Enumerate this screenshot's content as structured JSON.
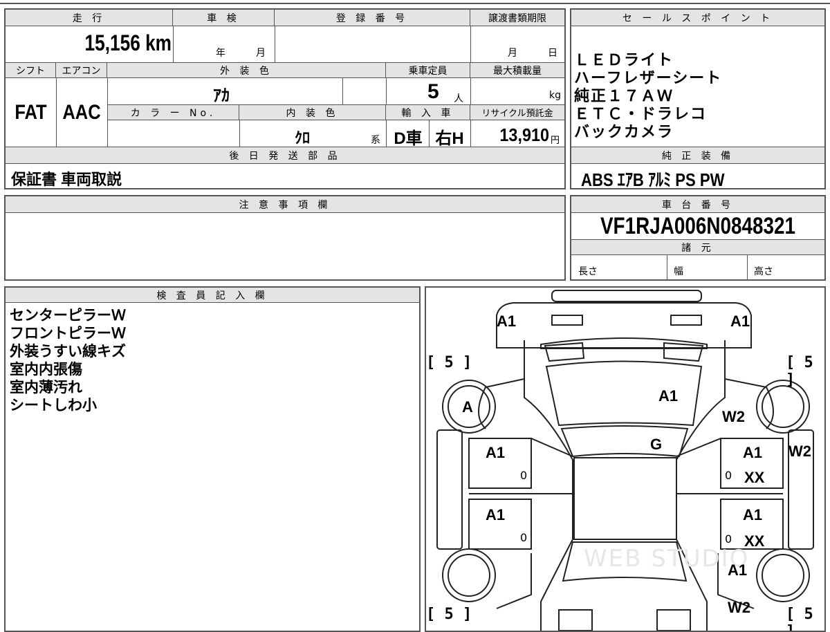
{
  "top_left": {
    "h_mileage": "走 行",
    "h_inspection": "車 検",
    "h_registration": "登 録 番 号",
    "h_transfer": "譲渡書類期限",
    "mileage": "15,156",
    "mileage_unit": "km",
    "insp_year": "年",
    "insp_month": "月",
    "transfer_month": "月",
    "transfer_day": "日",
    "h_shift": "シフト",
    "h_aircon": "エアコン",
    "h_exterior": "外 装 色",
    "h_capacity": "乗車定員",
    "h_maxload": "最大積載量",
    "shift": "FAT",
    "aircon": "AAC",
    "exterior_color": "ｱｶ",
    "capacity": "5",
    "capacity_unit": "人",
    "maxload_unit": "kg",
    "h_colorno": "カ ラ ー No.",
    "h_interior": "内 装 色",
    "h_import": "輸 入 車",
    "h_recycle": "リサイクル預託金",
    "interior_color": "ｸﾛ",
    "interior_suffix": "系",
    "import_type": "D車",
    "steering": "右H",
    "recycle_fee": "13,910",
    "recycle_unit": "円",
    "h_later_parts": "後 日 発 送 部 品",
    "later_parts": "保証書 車両取説"
  },
  "sales": {
    "header": "セ ー ル ス ポ イ ン ト",
    "items": [
      "ＬＥＤライト",
      "ハーフレザーシート",
      "純正１７ＡＷ",
      "ＥＴＣ・ドラレコ",
      "バックカメラ"
    ],
    "h_equipment": "純 正 装 備",
    "equipment": "ABS ｴｱB ｱﾙﾐ PS PW"
  },
  "notes": {
    "header": "注 意 事 項 欄"
  },
  "chassis": {
    "header": "車 台 番 号",
    "number": "VF1RJA006N0848321",
    "h_specs": "諸 元",
    "length": "長さ",
    "width": "幅",
    "height": "高さ"
  },
  "inspector": {
    "header": "検 査 員 記 入 欄",
    "lines": [
      "センターピラーＷ",
      "フロントピラーＷ",
      "外装うすい線キズ",
      "室内内張傷",
      "室内薄汚れ",
      "シートしわ小"
    ]
  },
  "diagram": {
    "tread_fl": "[ 5 ]",
    "tread_fr": "[ 5 ]",
    "tread_rl": "[ 5 ]",
    "tread_rr": "[ 5 ]",
    "front_bumper_left": "A1",
    "front_bumper_right": "A1",
    "hood": "A1",
    "windshield": "G",
    "left_front_wheel": "A",
    "right_fender": "W2",
    "right_pillar": "W2",
    "left_front_door": "A1",
    "left_front_door_num": "0",
    "left_rear_door": "A1",
    "left_rear_door_num": "0",
    "right_front_door": "A1",
    "right_front_door_code": "XX",
    "right_front_door_num": "0",
    "right_rear_door": "A1",
    "right_rear_door_code": "XX",
    "right_rear_door_num": "0",
    "right_quarter": "A1",
    "right_rear_quarter": "W2",
    "watermark": "WEB STUDIO"
  }
}
